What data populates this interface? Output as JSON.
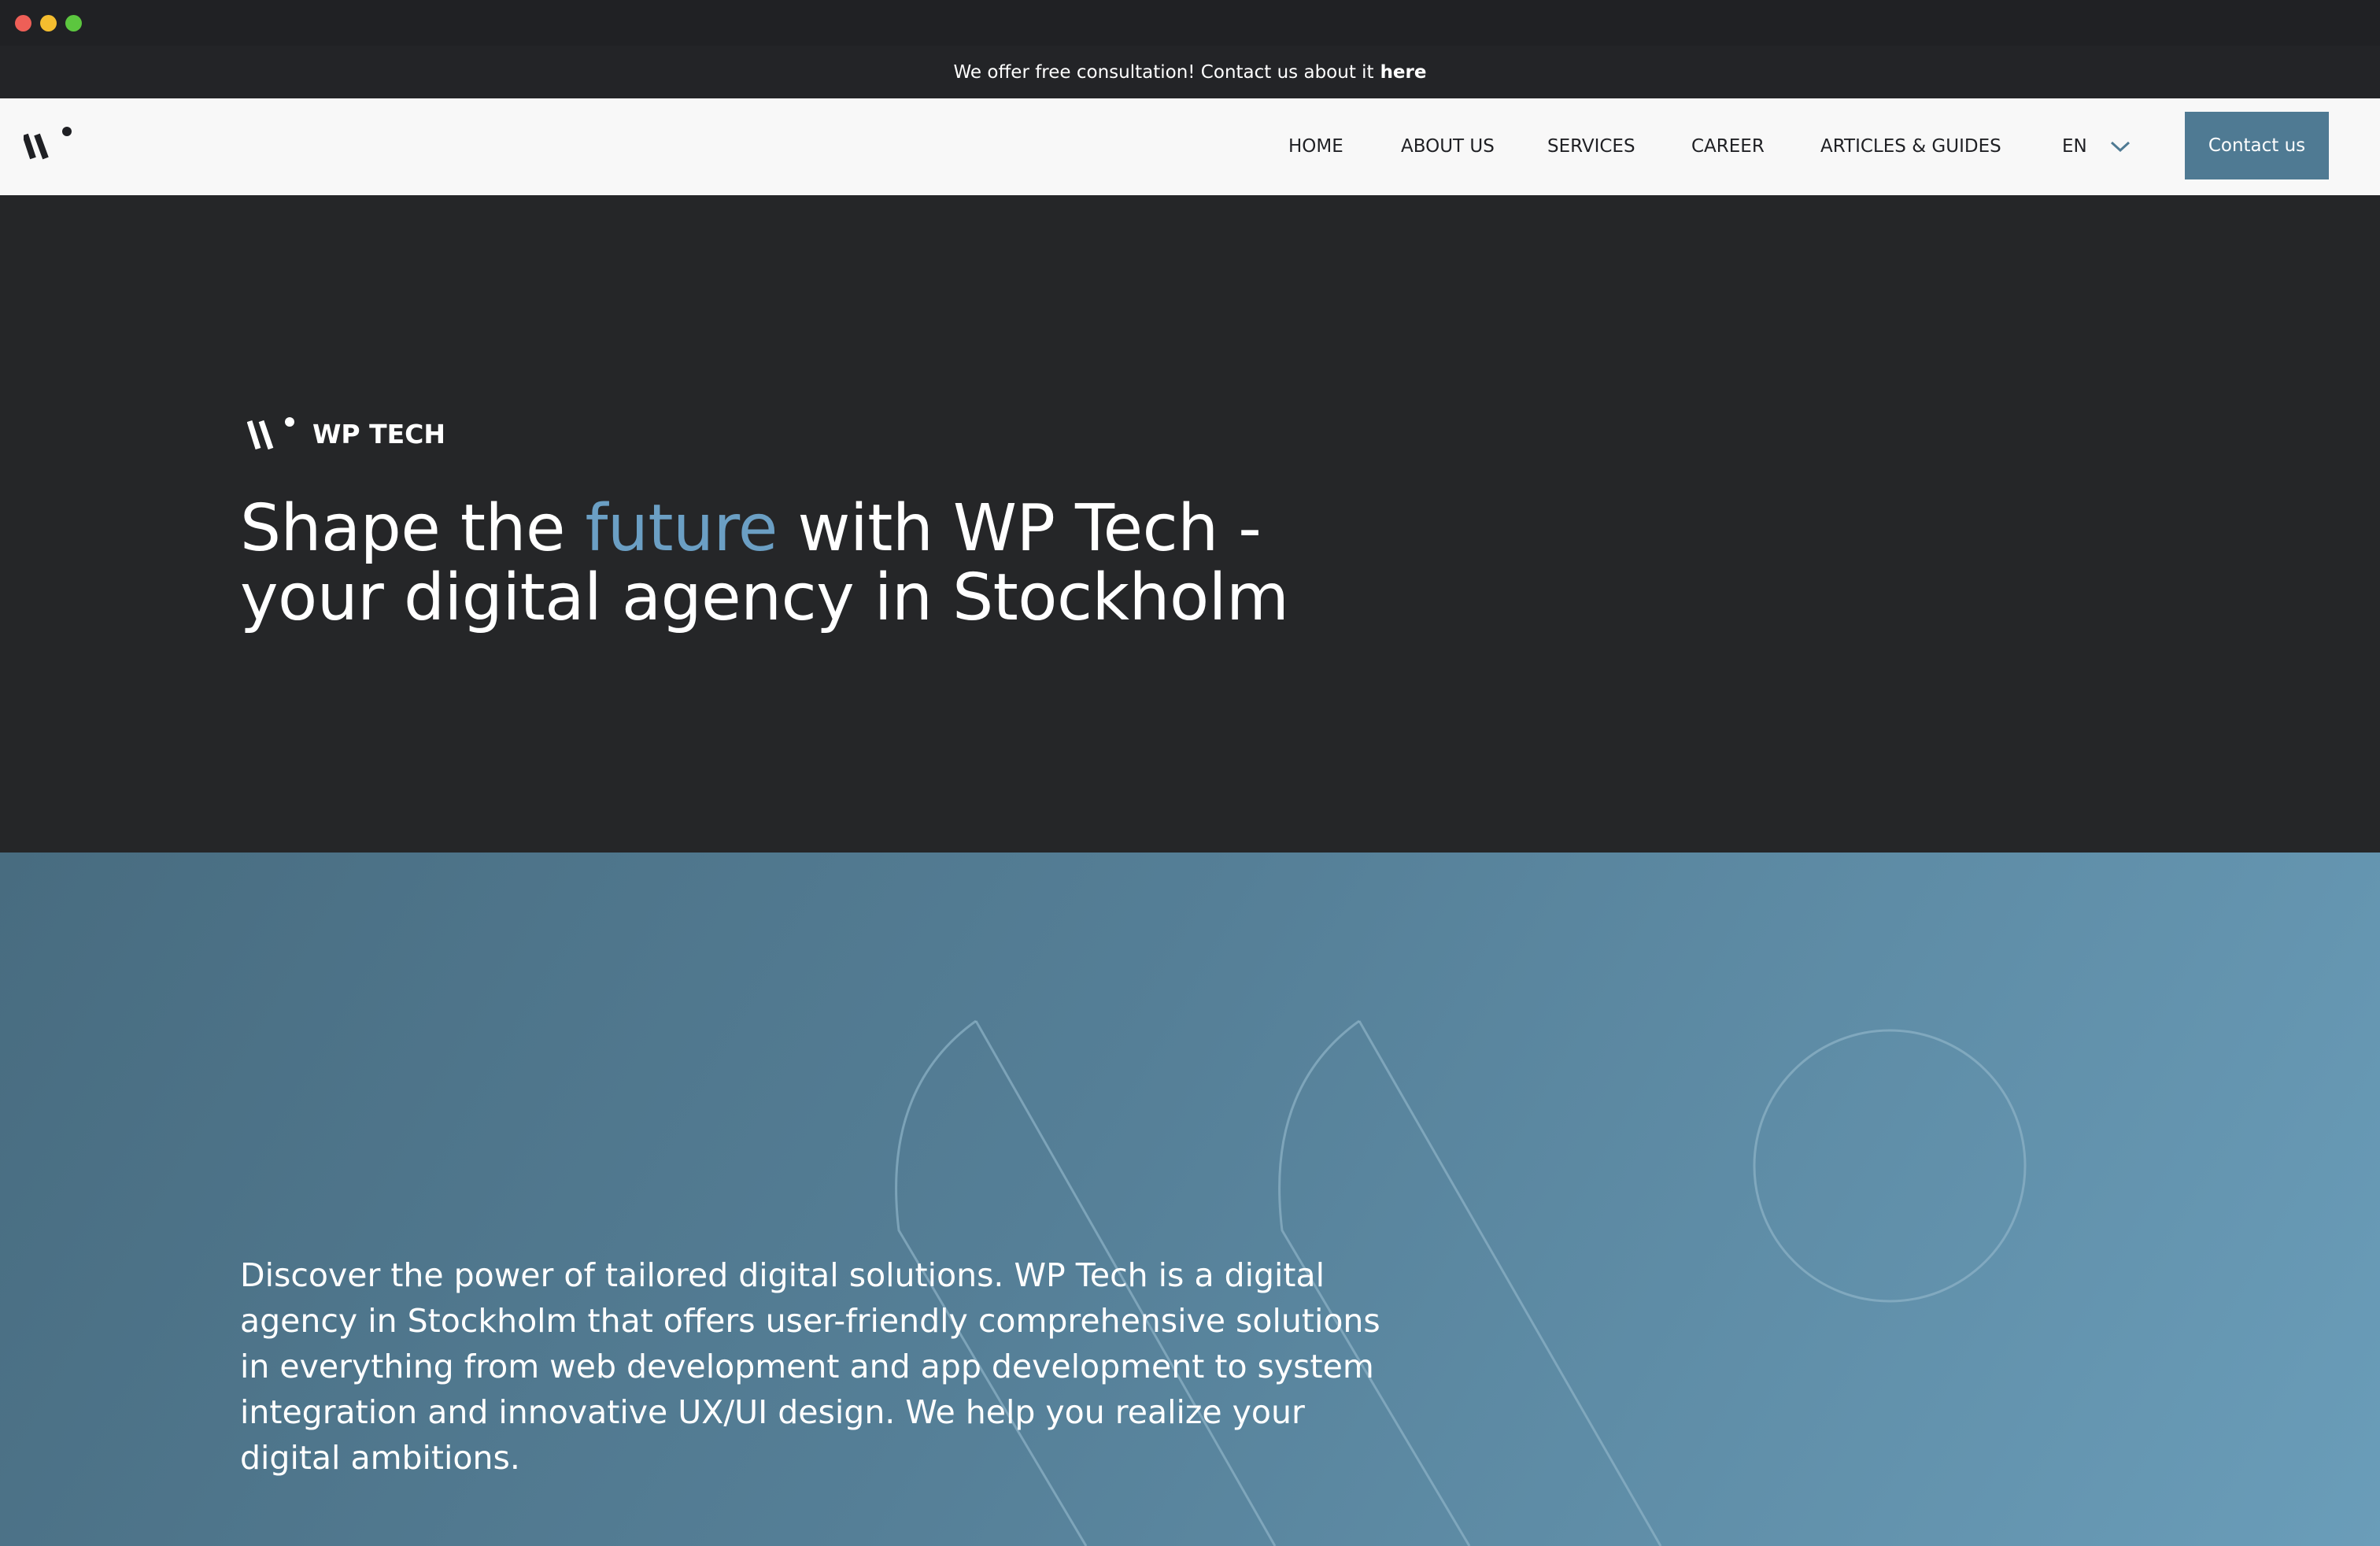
{
  "promo": {
    "text": "We offer free consultation! Contact us about it",
    "link": "here"
  },
  "nav": {
    "items": [
      "HOME",
      "ABOUT US",
      "SERVICES",
      "CAREER",
      "ARTICLES & GUIDES"
    ],
    "language": "EN",
    "contact_label": "Contact us"
  },
  "hero": {
    "brand_name": "WP TECH",
    "title_before": "Shape the ",
    "title_accent": "future",
    "title_after": " with WP Tech - your digital agency in Stockholm"
  },
  "intro": {
    "text": "Discover the power of tailored digital solutions. WP Tech is a digital agency in Stockholm that offers user-friendly comprehensive solutions in everything from web development and app development to system integration and innovative UX/UI design. We help you realize your digital ambitions."
  },
  "colors": {
    "accent": "#6b9fc4",
    "button": "#4f7a93",
    "dark_bg": "#252628"
  },
  "icons": [
    "wp-tech-logo-icon",
    "chevron-down-icon"
  ]
}
